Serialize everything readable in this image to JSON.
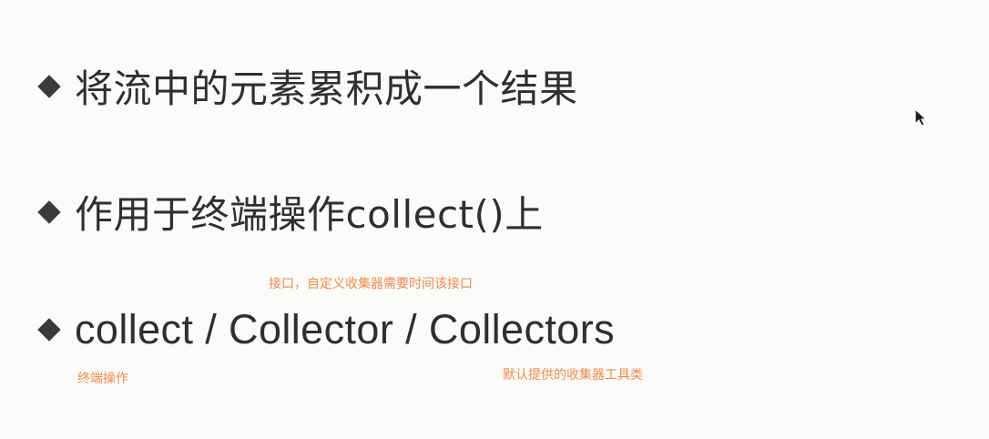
{
  "slide": {
    "bullets": [
      "将流中的元素累积成一个结果",
      "作用于终端操作collect()上",
      "collect / Collector / Collectors"
    ],
    "notes": {
      "collector": "接口，自定义收集器需要时间该接口",
      "collect": "终端操作",
      "collectors": "默认提供的收集器工具类"
    },
    "colors": {
      "background": "#fbfbf9",
      "text": "#2f2f2f",
      "bullet": "#3a3a3a",
      "annotation": "#ef8a4a"
    },
    "icons": {
      "bullet": "diamond-icon",
      "pointer": "mouse-pointer-icon"
    }
  }
}
